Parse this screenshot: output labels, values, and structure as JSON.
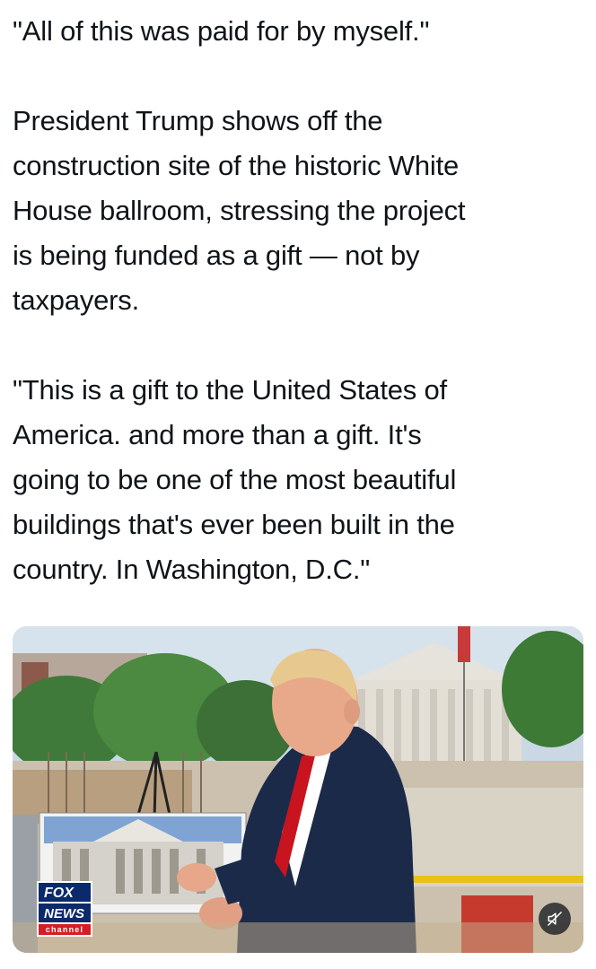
{
  "post": {
    "paragraphs": [
      "\"All of this was paid for by myself.\"",
      "President Trump shows off the\nconstruction site of the historic White\nHouse ballroom, stressing the project\nis being funded as a gift — not by\ntaxpayers.",
      "\"This is a gift to the United States of\nAmerica. and more than a gift. It's\ngoing to be one of the most beautiful\nbuildings that's ever been built in the\ncountry. In Washington, D.C.\""
    ]
  },
  "media": {
    "type": "video",
    "network_logo": {
      "line1": "FOX",
      "line2": "NEWS",
      "line3": "channel"
    },
    "mute_icon": "speaker-muted-icon"
  },
  "colors": {
    "text": "#0f1419",
    "fox_blue": "#0b2a6b",
    "fox_red": "#d11f26",
    "suit": "#1c2a4a",
    "tie": "#c8141e"
  }
}
